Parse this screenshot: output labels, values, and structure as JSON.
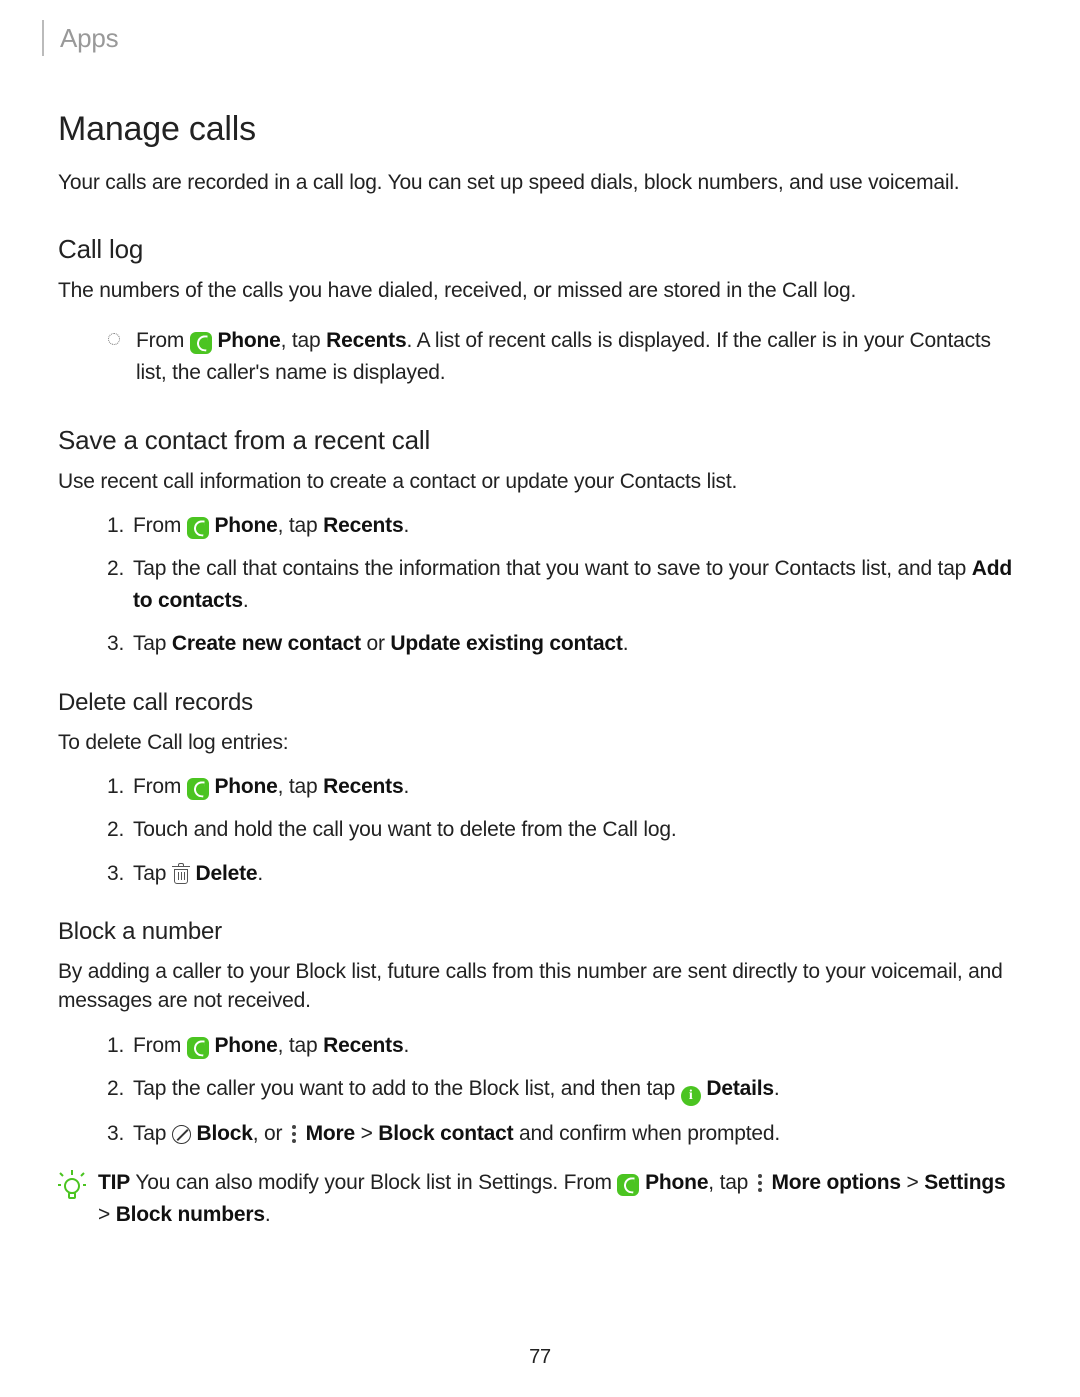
{
  "header": {
    "section": "Apps"
  },
  "title": "Manage calls",
  "intro": "Your calls are recorded in a call log. You can set up speed dials, block numbers, and use voicemail.",
  "calllog": {
    "heading": "Call log",
    "desc": "The numbers of the calls you have dialed, received, or missed are stored in the Call log.",
    "bullet_from": "From ",
    "bullet_phone": "Phone",
    "bullet_tap": ", tap ",
    "bullet_recents": "Recents",
    "bullet_rest": ". A list of recent calls is displayed. If the caller is in your Contacts list, the caller's name is displayed."
  },
  "save": {
    "heading": "Save a contact from a recent call",
    "desc": "Use recent call information to create a contact or update your Contacts list.",
    "s1_from": "From ",
    "s1_phone": "Phone",
    "s1_tap": ", tap ",
    "s1_recents": "Recents",
    "s1_dot": ".",
    "s2_a": "Tap the call that contains the information that you want to save to your Contacts list, and tap ",
    "s2_b": "Add to contacts",
    "s2_dot": ".",
    "s3_a": "Tap ",
    "s3_b": "Create new contact",
    "s3_or": " or ",
    "s3_c": "Update existing contact",
    "s3_dot": "."
  },
  "delete": {
    "heading": "Delete call records",
    "desc": "To delete Call log entries:",
    "d1_from": "From ",
    "d1_phone": "Phone",
    "d1_tap": ", tap ",
    "d1_recents": "Recents",
    "d1_dot": ".",
    "d2": "Touch and hold the call you want to delete from the Call log.",
    "d3_a": "Tap ",
    "d3_b": "Delete",
    "d3_dot": "."
  },
  "block": {
    "heading": "Block a number",
    "desc": "By adding a caller to your Block list, future calls from this number are sent directly to your voicemail, and messages are not received.",
    "b1_from": "From ",
    "b1_phone": "Phone",
    "b1_tap": ", tap ",
    "b1_recents": "Recents",
    "b1_dot": ".",
    "b2_a": "Tap the caller you want to add to the Block list, and then tap ",
    "b2_b": "Details",
    "b2_dot": ".",
    "b3_a": "Tap ",
    "b3_block": "Block",
    "b3_or": ", or ",
    "b3_more": "More",
    "b3_gt": " > ",
    "b3_bc": "Block contact",
    "b3_rest": " and confirm when prompted."
  },
  "tip": {
    "label": "TIP",
    "t1": "  You can also modify your Block list in Settings. From ",
    "phone": "Phone",
    "t2": ", tap ",
    "more": "More options",
    "gt1": " > ",
    "settings": "Settings",
    "gt2": " > ",
    "bn": "Block numbers",
    "dot": "."
  },
  "page": "77"
}
